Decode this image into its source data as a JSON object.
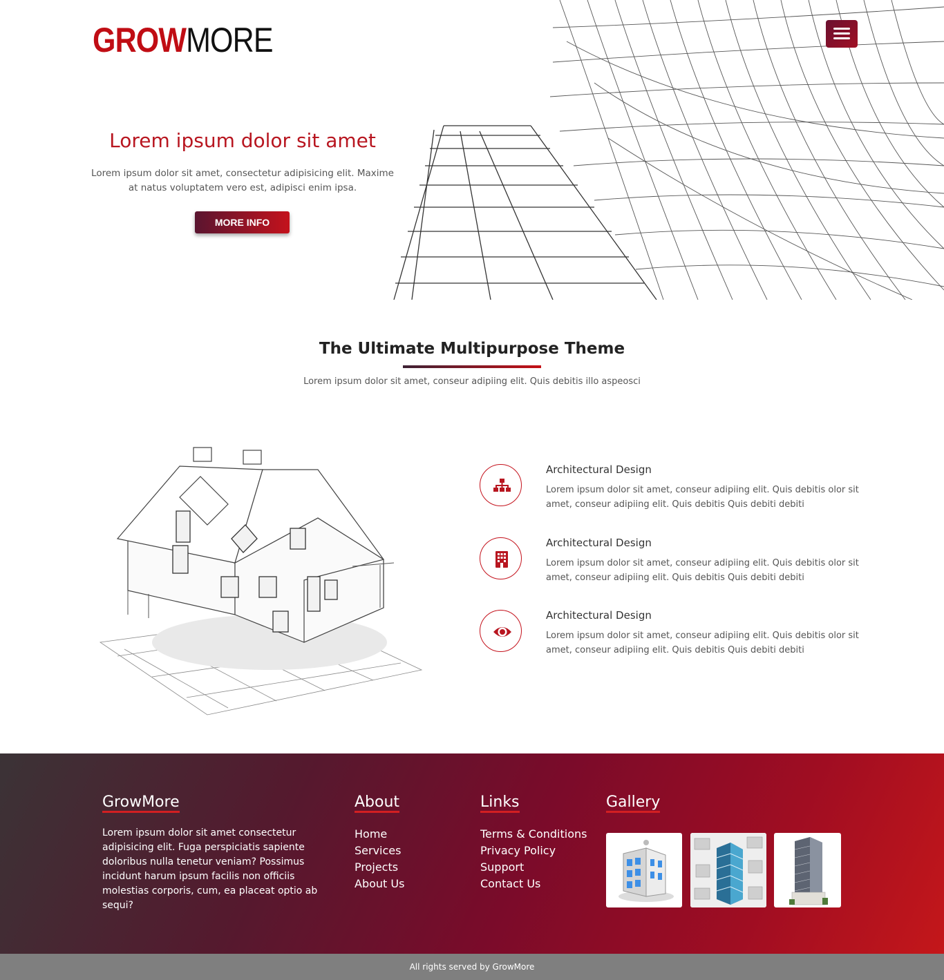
{
  "brand": {
    "logo_part1": "GROW",
    "logo_part2": "MORE",
    "accent": "#c00d14"
  },
  "header": {
    "menu_icon": "hamburger-icon"
  },
  "hero": {
    "title": "Lorem ipsum dolor sit amet",
    "text": "Lorem ipsum dolor sit amet, consectetur adipisicing elit. Maxime at natus voluptatem vero est, adipisci enim ipsa.",
    "button_label": "MORE INFO"
  },
  "intro": {
    "title": "The Ultimate Multipurpose Theme",
    "subtitle": "Lorem ipsum dolor sit amet, conseur adipiing elit. Quis debitis illo aspeosci"
  },
  "features": [
    {
      "icon": "sitemap-icon",
      "title": "Architectural Design",
      "text": "Lorem ipsum dolor sit amet, conseur adipiing elit. Quis debitis olor sit amet, conseur adipiing elit. Quis debitis Quis debiti debiti"
    },
    {
      "icon": "building-icon",
      "title": "Architectural Design",
      "text": "Lorem ipsum dolor sit amet, conseur adipiing elit. Quis debitis olor sit amet, conseur adipiing elit. Quis debitis Quis debiti debiti"
    },
    {
      "icon": "eye-icon",
      "title": "Architectural Design",
      "text": "Lorem ipsum dolor sit amet, conseur adipiing elit. Quis debitis olor sit amet, conseur adipiing elit. Quis debitis Quis debiti debiti"
    }
  ],
  "footer": {
    "about": {
      "heading": "GrowMore",
      "text": "Lorem ipsum dolor sit amet consectetur adipisicing elit. Fuga perspiciatis sapiente doloribus nulla tenetur veniam? Possimus incidunt harum ipsum facilis non officiis molestias corporis, cum, ea placeat optio ab sequi?"
    },
    "nav": {
      "heading": "About",
      "items": [
        "Home",
        "Services",
        "Projects",
        "About Us"
      ]
    },
    "links": {
      "heading": "Links",
      "items": [
        "Terms & Conditions",
        "Privacy Policy",
        "Support",
        "Contact Us"
      ]
    },
    "gallery": {
      "heading": "Gallery"
    },
    "copyright": "All rights served by GrowMore"
  }
}
